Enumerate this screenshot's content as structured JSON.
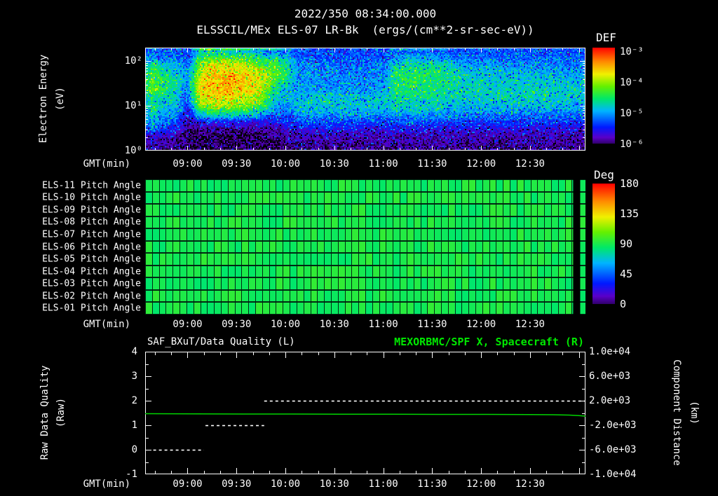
{
  "header": {
    "datetime": "2022/350 08:34:00.000",
    "instrument_title": "ELSSCIL/MEx ELS-07 LR-Bk",
    "units": "(ergs/(cm**2-sr-sec-eV))"
  },
  "colors": {
    "background": "#000000",
    "text": "#ffffff",
    "series_green": "#00d400",
    "title_green": "#00e800",
    "colormap": [
      [
        0.0,
        "#000000"
      ],
      [
        0.06,
        "#30006a"
      ],
      [
        0.12,
        "#5a00c8"
      ],
      [
        0.22,
        "#0018ff"
      ],
      [
        0.38,
        "#00b4ff"
      ],
      [
        0.5,
        "#00e868"
      ],
      [
        0.62,
        "#64f000"
      ],
      [
        0.74,
        "#f0f000"
      ],
      [
        0.86,
        "#ff8c00"
      ],
      [
        1.0,
        "#ff0000"
      ]
    ]
  },
  "time_axis": {
    "label": "GMT(min)",
    "start_gmt": "08:34",
    "span_min": 270,
    "tick_labels": [
      "09:00",
      "09:30",
      "10:00",
      "10:30",
      "11:00",
      "11:30",
      "12:00",
      "12:30"
    ]
  },
  "spectrogram": {
    "y_label_1": "Electron Energy",
    "y_label_2": "(eV)",
    "y_ticks": [
      "10²",
      "10¹",
      "10⁰"
    ],
    "colorbar": {
      "title": "DEF",
      "ticks": [
        "10⁻³",
        "10⁻⁴",
        "10⁻⁵",
        "10⁻⁶"
      ]
    }
  },
  "pitch_panel": {
    "rows": [
      "ELS-11 Pitch Angle",
      "ELS-10 Pitch Angle",
      "ELS-09 Pitch Angle",
      "ELS-08 Pitch Angle",
      "ELS-07 Pitch Angle",
      "ELS-06 Pitch Angle",
      "ELS-05 Pitch Angle",
      "ELS-04 Pitch Angle",
      "ELS-03 Pitch Angle",
      "ELS-02 Pitch Angle",
      "ELS-01 Pitch Angle"
    ],
    "colorbar": {
      "title": "Deg",
      "ticks": [
        "180",
        "135",
        "90",
        "45",
        "0"
      ]
    }
  },
  "bottom_panel": {
    "left_title": "SAF_BXuT/Data Quality (L)",
    "right_title": "MEXORBMC/SPF X, Spacecraft (R)",
    "left_axis": {
      "label_1": "Raw Data Quality",
      "label_2": "(Raw)",
      "ticks": [
        "4",
        "3",
        "2",
        "1",
        "0",
        "-1"
      ]
    },
    "right_axis": {
      "label_1": "Component Distance",
      "label_2": "(km)",
      "ticks": [
        "1.0e+04",
        "6.0e+03",
        "2.0e+03",
        "-2.0e+03",
        "-6.0e+03",
        "-1.0e+04"
      ]
    }
  },
  "chart_data": [
    {
      "type": "heatmap",
      "name": "electron_energy_spectrogram",
      "title": "ELSSCIL/MEx ELS-07 LR-Bk DEF",
      "x_start_gmt": "08:34",
      "x_span_min": 270,
      "y_label": "Electron Energy (eV)",
      "y_scale": "log",
      "y_range_ev": [
        1,
        200
      ],
      "z_label": "DEF (ergs/(cm**2-sr-sec-eV))",
      "z_scale": "log",
      "z_range": [
        1e-06,
        0.001
      ],
      "grid_note": "36 columns = 7.5-min bins from 08:34; each column lists relative log-intensity (0 => 1e-6, 1 => 1e-3) from 200 eV (top) to 1 eV (bottom)",
      "grid_columns": [
        [
          0.3,
          0.35,
          0.5,
          0.55,
          0.6,
          0.6,
          0.6,
          0.55,
          0.5,
          0.5,
          0.45,
          0.4,
          0.35,
          0.2,
          0.15,
          0.1
        ],
        [
          0.28,
          0.3,
          0.4,
          0.45,
          0.5,
          0.5,
          0.5,
          0.45,
          0.4,
          0.4,
          0.35,
          0.3,
          0.25,
          0.15,
          0.1,
          0.1
        ],
        [
          0.28,
          0.3,
          0.38,
          0.42,
          0.45,
          0.48,
          0.45,
          0.42,
          0.4,
          0.38,
          0.33,
          0.28,
          0.22,
          0.12,
          0.1,
          0.08
        ],
        [
          0.26,
          0.28,
          0.3,
          0.32,
          0.33,
          0.33,
          0.32,
          0.3,
          0.28,
          0.2,
          0.15,
          0.1,
          0.08,
          0.05,
          0.05,
          0.05
        ],
        [
          0.4,
          0.55,
          0.62,
          0.68,
          0.72,
          0.75,
          0.75,
          0.72,
          0.65,
          0.55,
          0.4,
          0.2,
          0.1,
          0.05,
          0.05,
          0.05
        ],
        [
          0.42,
          0.58,
          0.7,
          0.76,
          0.78,
          0.8,
          0.8,
          0.78,
          0.72,
          0.6,
          0.45,
          0.22,
          0.1,
          0.06,
          0.05,
          0.05
        ],
        [
          0.42,
          0.58,
          0.72,
          0.78,
          0.8,
          0.8,
          0.8,
          0.78,
          0.7,
          0.6,
          0.45,
          0.22,
          0.1,
          0.06,
          0.05,
          0.05
        ],
        [
          0.4,
          0.55,
          0.7,
          0.76,
          0.8,
          0.8,
          0.78,
          0.75,
          0.68,
          0.58,
          0.42,
          0.2,
          0.1,
          0.06,
          0.05,
          0.05
        ],
        [
          0.38,
          0.52,
          0.64,
          0.72,
          0.75,
          0.76,
          0.75,
          0.72,
          0.65,
          0.55,
          0.4,
          0.2,
          0.1,
          0.05,
          0.05,
          0.05
        ],
        [
          0.34,
          0.46,
          0.58,
          0.66,
          0.7,
          0.72,
          0.7,
          0.65,
          0.6,
          0.5,
          0.35,
          0.18,
          0.1,
          0.05,
          0.05,
          0.05
        ],
        [
          0.32,
          0.46,
          0.55,
          0.6,
          0.6,
          0.55,
          0.5,
          0.45,
          0.4,
          0.35,
          0.3,
          0.2,
          0.12,
          0.08,
          0.06,
          0.05
        ],
        [
          0.28,
          0.4,
          0.5,
          0.52,
          0.5,
          0.45,
          0.4,
          0.38,
          0.35,
          0.32,
          0.28,
          0.22,
          0.15,
          0.1,
          0.08,
          0.06
        ],
        [
          0.27,
          0.3,
          0.33,
          0.35,
          0.35,
          0.35,
          0.35,
          0.38,
          0.4,
          0.4,
          0.35,
          0.28,
          0.2,
          0.12,
          0.1,
          0.08
        ],
        [
          0.27,
          0.28,
          0.32,
          0.33,
          0.34,
          0.35,
          0.36,
          0.4,
          0.42,
          0.4,
          0.35,
          0.28,
          0.2,
          0.12,
          0.1,
          0.08
        ],
        [
          0.27,
          0.28,
          0.3,
          0.32,
          0.33,
          0.35,
          0.36,
          0.4,
          0.42,
          0.4,
          0.34,
          0.27,
          0.2,
          0.12,
          0.1,
          0.08
        ],
        [
          0.27,
          0.28,
          0.3,
          0.32,
          0.33,
          0.34,
          0.36,
          0.4,
          0.42,
          0.4,
          0.34,
          0.27,
          0.2,
          0.12,
          0.1,
          0.08
        ],
        [
          0.27,
          0.28,
          0.3,
          0.31,
          0.33,
          0.34,
          0.36,
          0.4,
          0.42,
          0.4,
          0.34,
          0.27,
          0.2,
          0.12,
          0.1,
          0.08
        ],
        [
          0.27,
          0.28,
          0.3,
          0.31,
          0.33,
          0.34,
          0.36,
          0.4,
          0.42,
          0.4,
          0.34,
          0.26,
          0.2,
          0.12,
          0.1,
          0.08
        ],
        [
          0.27,
          0.28,
          0.3,
          0.31,
          0.32,
          0.34,
          0.36,
          0.4,
          0.42,
          0.4,
          0.33,
          0.26,
          0.18,
          0.12,
          0.1,
          0.08
        ],
        [
          0.27,
          0.28,
          0.3,
          0.32,
          0.33,
          0.35,
          0.37,
          0.4,
          0.42,
          0.4,
          0.33,
          0.26,
          0.18,
          0.12,
          0.1,
          0.08
        ],
        [
          0.28,
          0.35,
          0.45,
          0.5,
          0.52,
          0.52,
          0.5,
          0.48,
          0.45,
          0.42,
          0.35,
          0.28,
          0.2,
          0.12,
          0.1,
          0.08
        ],
        [
          0.28,
          0.36,
          0.46,
          0.5,
          0.52,
          0.52,
          0.5,
          0.48,
          0.45,
          0.42,
          0.35,
          0.28,
          0.2,
          0.12,
          0.1,
          0.08
        ],
        [
          0.28,
          0.36,
          0.46,
          0.5,
          0.52,
          0.52,
          0.5,
          0.48,
          0.45,
          0.42,
          0.35,
          0.28,
          0.2,
          0.12,
          0.1,
          0.08
        ],
        [
          0.28,
          0.35,
          0.45,
          0.5,
          0.5,
          0.5,
          0.5,
          0.47,
          0.44,
          0.4,
          0.34,
          0.27,
          0.2,
          0.12,
          0.1,
          0.08
        ],
        [
          0.28,
          0.33,
          0.42,
          0.46,
          0.48,
          0.48,
          0.47,
          0.45,
          0.42,
          0.4,
          0.33,
          0.26,
          0.18,
          0.12,
          0.1,
          0.08
        ],
        [
          0.27,
          0.3,
          0.38,
          0.42,
          0.44,
          0.45,
          0.45,
          0.43,
          0.41,
          0.38,
          0.32,
          0.26,
          0.18,
          0.12,
          0.1,
          0.08
        ],
        [
          0.27,
          0.3,
          0.36,
          0.4,
          0.42,
          0.44,
          0.44,
          0.42,
          0.4,
          0.38,
          0.32,
          0.25,
          0.18,
          0.12,
          0.1,
          0.08
        ],
        [
          0.27,
          0.3,
          0.36,
          0.4,
          0.42,
          0.43,
          0.43,
          0.42,
          0.4,
          0.37,
          0.31,
          0.25,
          0.18,
          0.12,
          0.1,
          0.08
        ],
        [
          0.27,
          0.3,
          0.35,
          0.38,
          0.4,
          0.42,
          0.43,
          0.43,
          0.42,
          0.38,
          0.32,
          0.25,
          0.18,
          0.12,
          0.1,
          0.08
        ],
        [
          0.27,
          0.3,
          0.34,
          0.38,
          0.4,
          0.42,
          0.44,
          0.44,
          0.42,
          0.38,
          0.32,
          0.25,
          0.18,
          0.12,
          0.1,
          0.08
        ],
        [
          0.27,
          0.29,
          0.34,
          0.37,
          0.4,
          0.42,
          0.44,
          0.44,
          0.42,
          0.38,
          0.32,
          0.25,
          0.18,
          0.12,
          0.1,
          0.08
        ],
        [
          0.27,
          0.29,
          0.34,
          0.37,
          0.4,
          0.42,
          0.44,
          0.44,
          0.42,
          0.38,
          0.31,
          0.25,
          0.18,
          0.12,
          0.1,
          0.08
        ],
        [
          0.27,
          0.29,
          0.33,
          0.36,
          0.39,
          0.41,
          0.43,
          0.43,
          0.41,
          0.38,
          0.31,
          0.24,
          0.17,
          0.12,
          0.1,
          0.08
        ],
        [
          0.27,
          0.29,
          0.33,
          0.36,
          0.39,
          0.41,
          0.43,
          0.43,
          0.41,
          0.37,
          0.31,
          0.24,
          0.17,
          0.12,
          0.1,
          0.08
        ],
        [
          0.27,
          0.29,
          0.33,
          0.36,
          0.38,
          0.4,
          0.42,
          0.42,
          0.4,
          0.37,
          0.3,
          0.24,
          0.17,
          0.11,
          0.1,
          0.08
        ],
        [
          0.27,
          0.29,
          0.33,
          0.35,
          0.38,
          0.4,
          0.42,
          0.42,
          0.4,
          0.36,
          0.3,
          0.24,
          0.17,
          0.11,
          0.1,
          0.08
        ]
      ]
    },
    {
      "type": "heatmap",
      "name": "pitch_angles",
      "rows": [
        "ELS-11",
        "ELS-10",
        "ELS-09",
        "ELS-08",
        "ELS-07",
        "ELS-06",
        "ELS-05",
        "ELS-04",
        "ELS-03",
        "ELS-02",
        "ELS-01"
      ],
      "units": "Deg",
      "value_range": [
        0,
        180
      ],
      "approx_value_deg": 95,
      "jitter_deg": 6,
      "columns_estimate": 64,
      "data_gap_frac": [
        0.972,
        0.988
      ],
      "x_start_gmt": "08:34",
      "x_span_min": 270
    },
    {
      "type": "line",
      "name": "quality_and_spacecraft_x",
      "x_start_gmt": "08:34",
      "x_span_min": 270,
      "left_axis_range": [
        -1,
        4
      ],
      "right_axis_range": [
        -10000,
        10000
      ],
      "left_series": {
        "name": "SAF_BXuT/Data Quality",
        "units": "Raw",
        "style": "dashed-white",
        "segments": [
          {
            "start_min": 5,
            "end_min": 36,
            "value": 0
          },
          {
            "start_min": 37,
            "end_min": 73,
            "value": 1
          },
          {
            "start_min": 73,
            "end_min": 270,
            "value": 2
          }
        ]
      },
      "right_series": {
        "name": "MEXORBMC/SPF X, Spacecraft",
        "units": "km",
        "style": "solid-green",
        "points": [
          [
            0,
            -120
          ],
          [
            30,
            -140
          ],
          [
            60,
            -160
          ],
          [
            90,
            -175
          ],
          [
            120,
            -190
          ],
          [
            150,
            -205
          ],
          [
            180,
            -220
          ],
          [
            210,
            -240
          ],
          [
            235,
            -260
          ],
          [
            250,
            -290
          ],
          [
            260,
            -340
          ],
          [
            266,
            -420
          ],
          [
            270,
            -520
          ]
        ]
      }
    }
  ]
}
